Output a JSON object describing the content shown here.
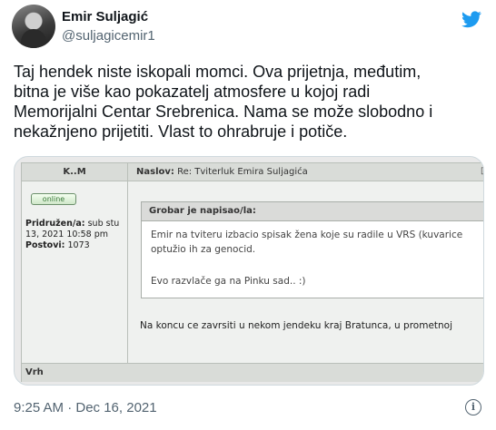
{
  "tweet": {
    "author_name": "Emir Suljagić",
    "author_handle": "@suljagicemir1",
    "text_lines": [
      "Taj hendek niste iskopali momci. Ova prijetnja, međutim,",
      "bitna je više kao pokazatelj atmosfere u kojoj radi",
      "Memorijalni Centar Srebrenica. Nama se može slobodno i",
      "nekažnjeno prijetiti. Vlast to ohrabruje i potiče."
    ],
    "timestamp": "9:25 AM · Dec 16, 2021",
    "info_icon": "i"
  },
  "forum": {
    "author_col": "K..M",
    "subject_label": "Naslov:",
    "subject_value": "Re: Tviterluk Emira Suljagića",
    "subject_icon": "□Po",
    "status": "online",
    "joined_label": "Pridružen/a:",
    "joined_value": "sub stu",
    "joined_value2": "13, 2021 10:58 pm",
    "posts_label": "Postovi:",
    "posts_value": "1073",
    "quote_header": "Grobar je napisao/la:",
    "quote_line1": "Emir na tviteru izbacio spisak žena koje su radile u VRS (kuvarice",
    "quote_line2": "optužio ih za genocid.",
    "quote_line3": "Evo razvlače ga na Pinku sad.. :)",
    "reply_text": "Na koncu ce zavrsiti u nekom jendeku kraj Bratunca, u prometnoj",
    "back_to_top": "Vrh"
  },
  "colors": {
    "twitter_blue": "#1d9bf0",
    "text_primary": "#0f1419",
    "text_secondary": "#536471"
  }
}
